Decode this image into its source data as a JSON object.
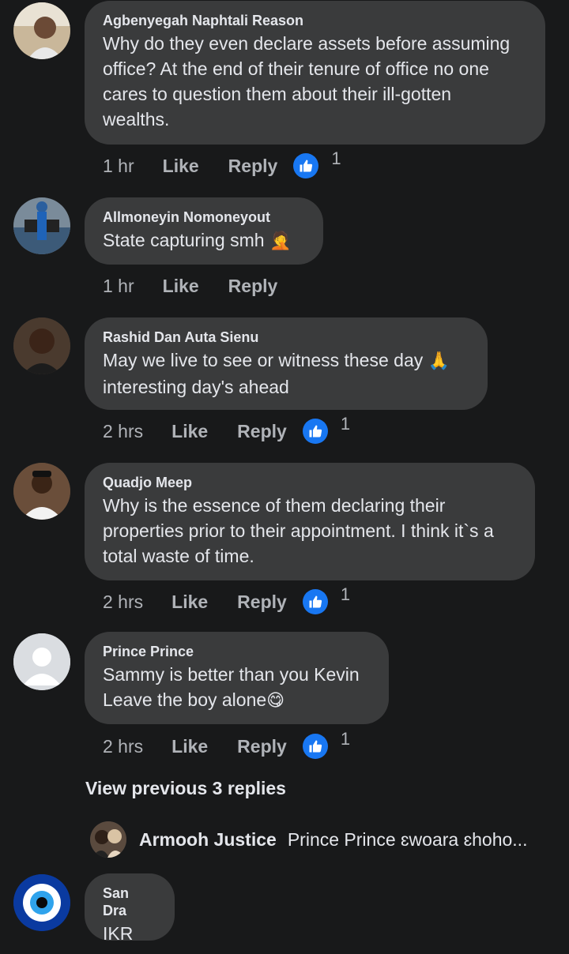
{
  "comments": [
    {
      "name": "Agbenyegah Naphtali Reason",
      "text": "Why do they even declare assets before assuming\noffice? At the end of their tenure of office no one\ncares to question them about their ill-gotten\nwealths.",
      "time": "1 hr",
      "like": "Like",
      "reply": "Reply",
      "reactions": "1"
    },
    {
      "name": "Allmoneyin Nomoneyout",
      "text": "State capturing smh",
      "emoji": "🤦",
      "time": "1 hr",
      "like": "Like",
      "reply": "Reply"
    },
    {
      "name": "Rashid Dan Auta Sienu",
      "text": "May we live to see or witness these day",
      "emoji": "🙏",
      "text2": "interesting day's ahead",
      "time": "2 hrs",
      "like": "Like",
      "reply": "Reply",
      "reactions": "1"
    },
    {
      "name": "Quadjo Meep",
      "text": "Why is the essence of them declaring their\nproperties prior to their appointment. I think it`s a\ntotal waste of time.",
      "time": "2 hrs",
      "like": "Like",
      "reply": "Reply",
      "reactions": "1"
    },
    {
      "name": "Prince Prince",
      "text": "Sammy is better than you Kevin",
      "text2": "Leave the boy alone",
      "emoji": "😋",
      "time": "2 hrs",
      "like": "Like",
      "reply": "Reply",
      "reactions": "1"
    }
  ],
  "view_previous": "View previous 3 replies",
  "reply_preview": {
    "name": "Armooh Justice",
    "text": "Prince Prince ɛwoara ɛhoho..."
  },
  "last_comment": {
    "name": "San Dra",
    "text": "IKR"
  },
  "colors": {
    "background": "#18191a",
    "bubble": "#3a3b3c",
    "like_blue": "#1877f2",
    "muted": "#b0b3b8"
  }
}
